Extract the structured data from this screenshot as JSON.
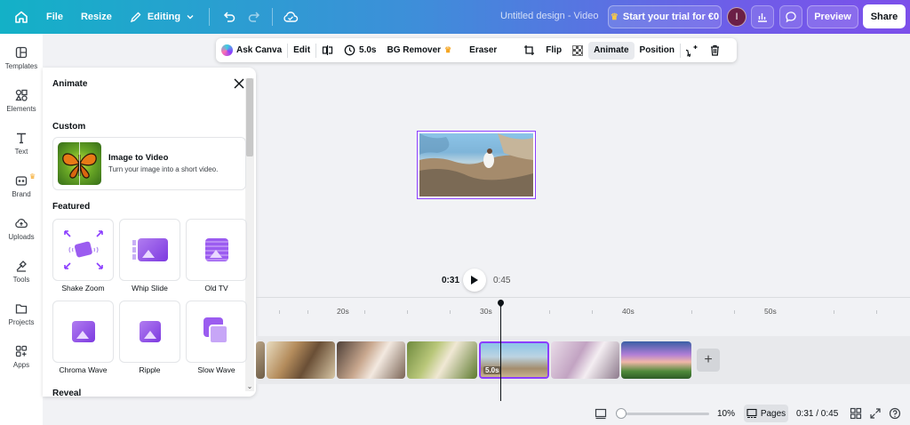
{
  "topbar": {
    "file": "File",
    "resize": "Resize",
    "editing": "Editing",
    "doc_title": "Untitled design - Video",
    "trial": "Start your trial for €0",
    "avatar_initial": "I",
    "preview": "Preview",
    "share": "Share"
  },
  "rail": {
    "templates": "Templates",
    "elements": "Elements",
    "text": "Text",
    "brand": "Brand",
    "uploads": "Uploads",
    "tools": "Tools",
    "projects": "Projects",
    "apps": "Apps"
  },
  "panel": {
    "title": "Animate",
    "custom_heading": "Custom",
    "custom_title": "Image to Video",
    "custom_desc": "Turn your image into a short video.",
    "featured_heading": "Featured",
    "reveal_heading": "Reveal",
    "tiles": [
      "Shake Zoom",
      "Whip Slide",
      "Old TV",
      "Chroma Wave",
      "Ripple",
      "Slow Wave"
    ]
  },
  "ctx": {
    "ask_canva": "Ask Canva",
    "edit": "Edit",
    "duration": "5.0s",
    "bg_remover": "BG Remover",
    "eraser": "Eraser",
    "flip": "Flip",
    "animate": "Animate",
    "position": "Position"
  },
  "player": {
    "current": "0:31",
    "total": "0:45"
  },
  "timeline": {
    "ticks": [
      "20s",
      "30s",
      "40s",
      "50s"
    ],
    "selected_duration": "5.0s"
  },
  "bottom": {
    "zoom": "10%",
    "zoom_level_fraction": 0.1,
    "pages": "Pages",
    "time": "0:31 / 0:45"
  },
  "colors": {
    "accent": "#8b3dff",
    "topbar_start": "#13b1c7",
    "topbar_end": "#7c4fea"
  }
}
